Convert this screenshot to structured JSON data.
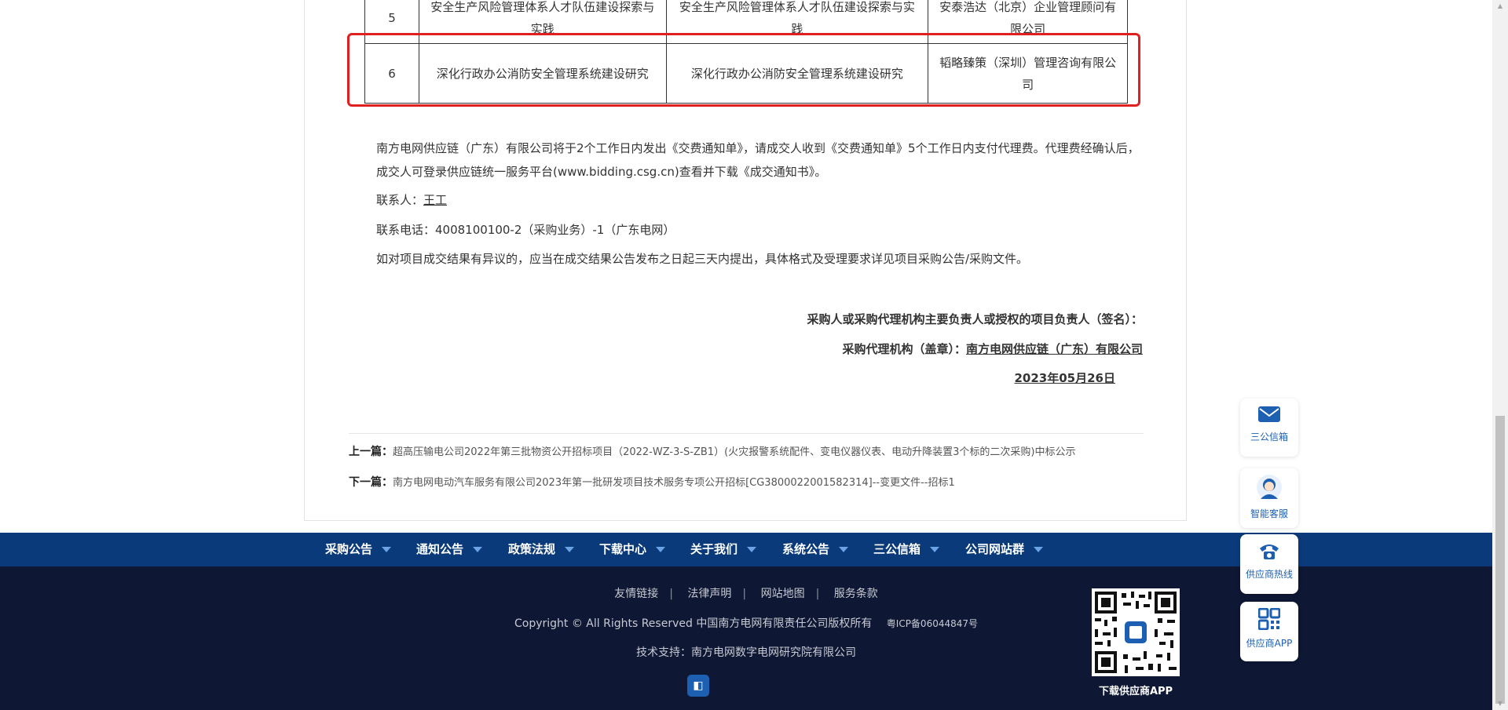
{
  "table": {
    "rows": [
      {
        "no": "5",
        "project": "安全生产风险管理体系人才队伍建设探索与实践",
        "content": "安全生产风险管理体系人才队伍建设探索与实践",
        "company": "安泰浩达（北京）企业管理顾问有限公司"
      },
      {
        "no": "6",
        "project": "深化行政办公消防安全管理系统建设研究",
        "content": "深化行政办公消防安全管理系统建设研究",
        "company": "韬略臻策（深圳）管理咨询有限公司"
      }
    ]
  },
  "body": {
    "notice_part1": "南方电网供应链（广东）有限公司将于2个工作日内发出《交费通知单》，请成交人收到《交费通知单》5个工作日内支付代理费。代理费经确认后，成交人可登录供应链统一服务平台(www.bidding.csg.cn)查看并下载《成交通知书》。",
    "contact_label": "联系人：",
    "contact_name": "王工",
    "phone": "联系电话：4008100100-2（采购业务）-1（广东电网）",
    "objection": "如对项目成交结果有异议的，应当在成交结果公告发布之日起三天内提出，具体格式及受理要求详见项目采购公告/采购文件。"
  },
  "signature": {
    "line1": "采购人或采购代理机构主要负责人或授权的项目负责人（签名）：",
    "line2_label": "采购代理机构（盖章）：",
    "line2_org": "南方电网供应链（广东）有限公司",
    "date": "2023年05月26日"
  },
  "article_nav": {
    "prev_label": "上一篇：",
    "prev_title": "超高压输电公司2022年第三批物资公开招标项目（2022-WZ-3-S-ZB1）(火灾报警系统配件、变电仪器仪表、电动升降装置3个标的二次采购)中标公示",
    "next_label": "下一篇：",
    "next_title": "南方电网电动汽车服务有限公司2023年第一批研发项目技术服务专项公开招标[CG3800022001582314]--变更文件--招标1"
  },
  "menu": {
    "items": [
      "采购公告",
      "通知公告",
      "政策法规",
      "下载中心",
      "关于我们",
      "系统公告",
      "三公信箱",
      "公司网站群"
    ]
  },
  "footer": {
    "links": [
      "友情链接",
      "法律声明",
      "网站地图",
      "服务条款"
    ],
    "copyright": "Copyright © All Rights Reserved 中国南方电网有限责任公司版权所有",
    "icp": "粤ICP备06044847号",
    "tech_support": "技术支持：南方电网数字电网研究院有限公司",
    "qr_label": "下载供应商APP"
  },
  "side_buttons": [
    {
      "label": "三公信箱",
      "icon": "mail-icon"
    },
    {
      "label": "智能客服",
      "icon": "customer-service-icon"
    },
    {
      "label": "供应商热线",
      "icon": "phone-icon"
    },
    {
      "label": "供应商APP",
      "icon": "qr-app-icon"
    }
  ],
  "colors": {
    "menu_bar": "#0a3a7a",
    "footer_bg": "#0e1733",
    "highlight": "#e02020",
    "brand_blue": "#1d5fb0"
  }
}
